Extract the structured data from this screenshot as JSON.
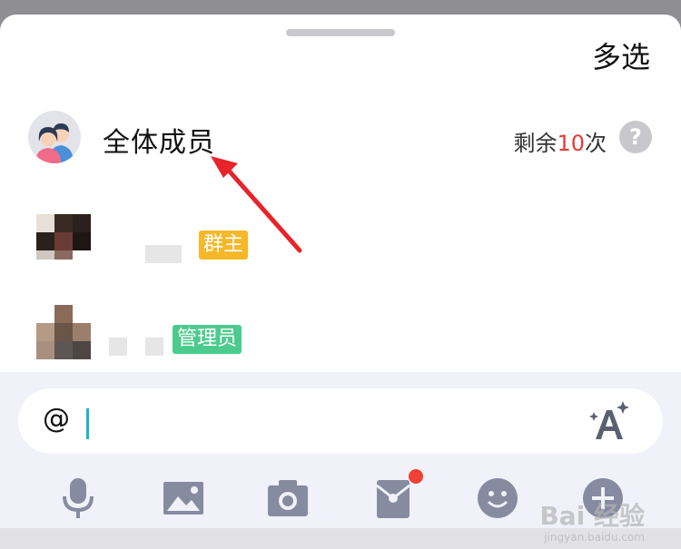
{
  "header": {
    "multi_select_label": "多选"
  },
  "mention_all": {
    "label": "全体成员",
    "remaining_prefix": "剩余",
    "remaining_count": "10",
    "remaining_suffix": "次",
    "help_symbol": "?"
  },
  "members": [
    {
      "role_badge": "群主",
      "badge_color": "#f6b728"
    },
    {
      "role_badge": "管理员",
      "badge_color": "#4dcb8e"
    }
  ],
  "composer": {
    "input_value": "@"
  },
  "toolbar": {
    "icons": [
      "microphone-icon",
      "image-icon",
      "camera-icon",
      "red-packet-icon",
      "emoji-icon",
      "plus-icon"
    ],
    "notification_color": "#f04134"
  },
  "watermark": {
    "text": "Bai 经验",
    "sub": "jingyan.baidu.com"
  },
  "colors": {
    "accent_caret": "#1cb5c7",
    "annotation_arrow": "#e8232a"
  }
}
